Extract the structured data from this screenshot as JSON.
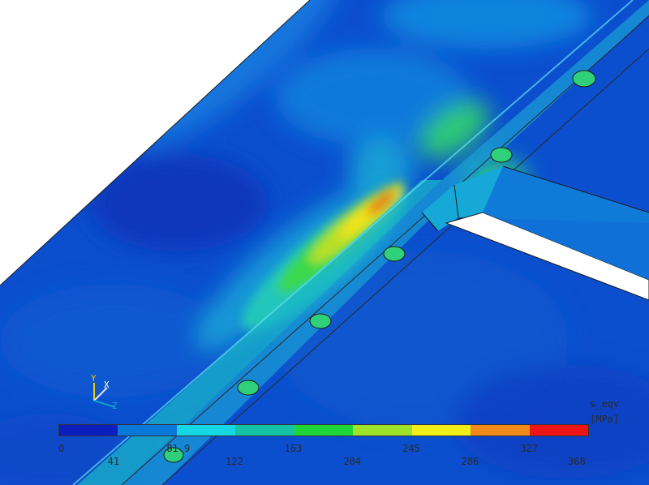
{
  "result": {
    "quantity_label": "s_eqv",
    "unit_label": "[MPa]"
  },
  "colorbar": {
    "colors": [
      "#0b1fbf",
      "#0a78d8",
      "#14d7e3",
      "#14c3a6",
      "#1fd63a",
      "#9ee22a",
      "#f2ee1a",
      "#f08a19",
      "#ec1414"
    ],
    "labels_top": [
      "0",
      "81.9",
      "163",
      "245",
      "327"
    ],
    "labels_bottom": [
      "41",
      "122",
      "204",
      "286",
      "368"
    ]
  },
  "triad": {
    "x_label": "X",
    "y_label": "Y",
    "z_label": "Z",
    "x_color": "#e8e8e8",
    "y_color": "#e0d000",
    "z_color": "#16a0c8"
  }
}
